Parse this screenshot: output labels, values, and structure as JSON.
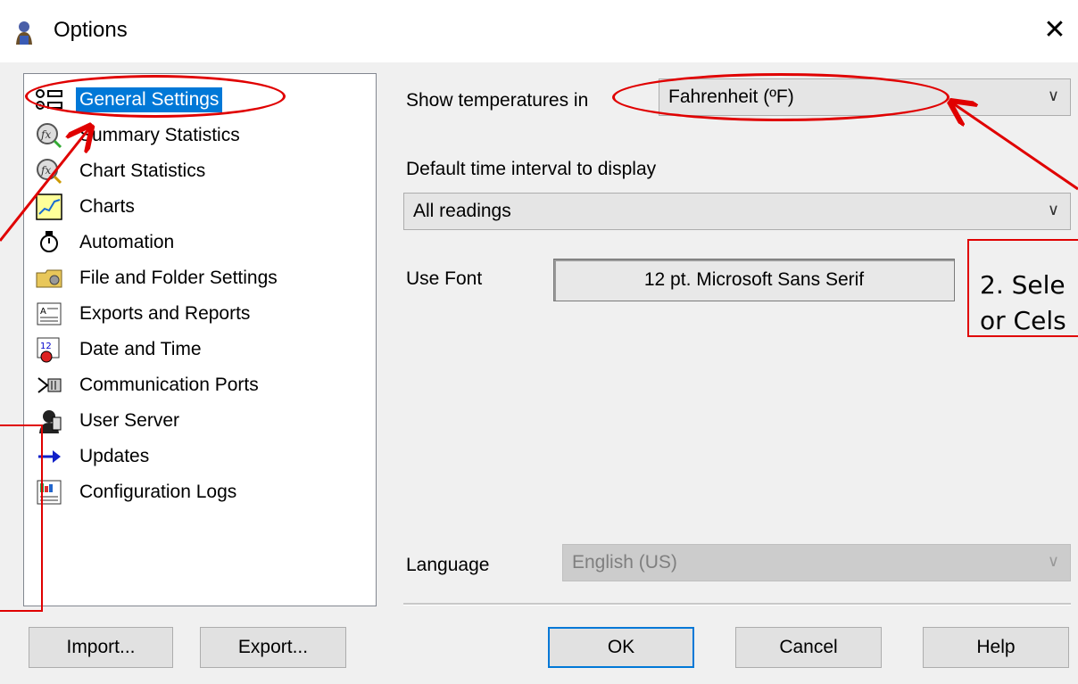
{
  "window": {
    "title": "Options",
    "close_glyph": "✕"
  },
  "nav": {
    "items": [
      {
        "label": "General Settings",
        "icon": "general-settings-icon",
        "selected": true
      },
      {
        "label": "Summary Statistics",
        "icon": "summary-statistics-icon"
      },
      {
        "label": "Chart Statistics",
        "icon": "chart-statistics-icon"
      },
      {
        "label": "Charts",
        "icon": "charts-icon"
      },
      {
        "label": "Automation",
        "icon": "automation-icon"
      },
      {
        "label": "File and Folder Settings",
        "icon": "folder-settings-icon"
      },
      {
        "label": "Exports and Reports",
        "icon": "exports-reports-icon"
      },
      {
        "label": "Date and Time",
        "icon": "calendar-clock-icon"
      },
      {
        "label": "Communication Ports",
        "icon": "comm-ports-icon"
      },
      {
        "label": "User Server",
        "icon": "user-server-icon"
      },
      {
        "label": "Updates",
        "icon": "arrow-right-icon"
      },
      {
        "label": "Configuration Logs",
        "icon": "config-logs-icon"
      }
    ]
  },
  "form": {
    "temp_label": "Show temperatures in",
    "temp_value": "Fahrenheit (ºF)",
    "interval_label": "Default time interval to display",
    "interval_value": "All readings",
    "font_label": "Use Font",
    "font_value": "12 pt. Microsoft Sans Serif",
    "language_label": "Language",
    "language_value": "English (US)",
    "chevron": "∨"
  },
  "buttons": {
    "import": "Import...",
    "export": "Export...",
    "ok": "OK",
    "cancel": "Cancel",
    "help": "Help"
  },
  "annotation": {
    "callout_line1": "2. Sele",
    "callout_line2": "or Cels",
    "color": "#e00000"
  }
}
